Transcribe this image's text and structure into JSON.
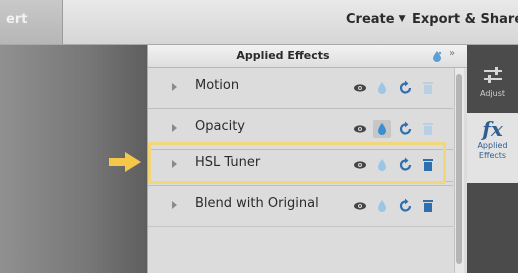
{
  "menubar": {
    "left_label": "ert",
    "create_label": "Create",
    "export_label": "Export & Share"
  },
  "panel": {
    "title": "Applied Effects",
    "effects": [
      {
        "label": "Motion",
        "selected_icon": ""
      },
      {
        "label": "Opacity",
        "selected_icon": "drop"
      },
      {
        "label": "HSL Tuner",
        "selected_icon": ""
      },
      {
        "label": "Blend with Original",
        "selected_icon": ""
      }
    ]
  },
  "sidebar": {
    "adjust_label": "Adjust",
    "fx_glyph": "fx",
    "applied_label_line1": "Applied",
    "applied_label_line2": "Effects"
  },
  "colors": {
    "accent_blue": "#2f6fb0",
    "highlight": "#f2d77a",
    "arrow": "#f5c84a"
  },
  "icons": [
    "eye-icon",
    "drop-icon",
    "reset-icon",
    "trash-icon",
    "expand-icon",
    "adjust-sliders-icon",
    "fx-icon",
    "arrow-right-icon"
  ]
}
